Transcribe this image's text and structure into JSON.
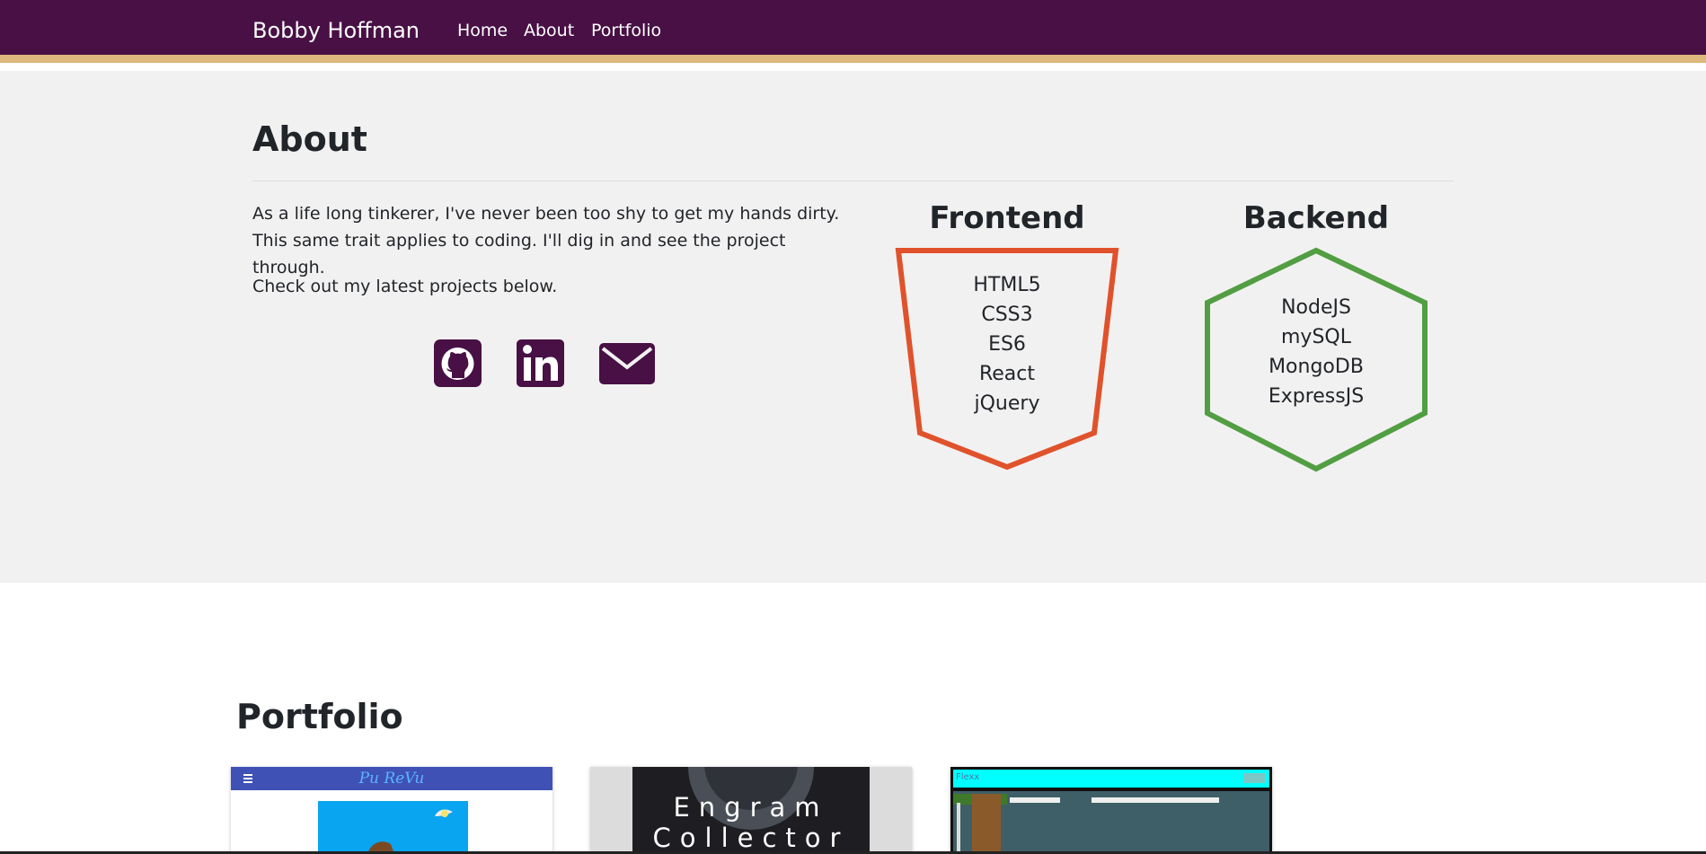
{
  "nav": {
    "brand": "Bobby Hoffman",
    "links": [
      "Home",
      "About",
      "Portfolio"
    ]
  },
  "about": {
    "title": "About",
    "paragraph1": "As a life long tinkerer, I've never been too shy to get my hands dirty. This same trait applies to coding. I'll dig in and see the project through.",
    "paragraph2": "Check out my latest projects below.",
    "social_icons": [
      "github-icon",
      "linkedin-icon",
      "envelope-icon"
    ]
  },
  "skills": {
    "frontend": {
      "title": "Frontend",
      "items": [
        "HTML5",
        "CSS3",
        "ES6",
        "React",
        "jQuery"
      ],
      "color": "#e0522c"
    },
    "backend": {
      "title": "Backend",
      "items": [
        "NodeJS",
        "mySQL",
        "MongoDB",
        "ExpressJS"
      ],
      "color": "#529e43"
    }
  },
  "portfolio": {
    "title": "Portfolio",
    "cards": [
      {
        "title": "Pu ReVu"
      },
      {
        "title": "Engram Collector"
      },
      {
        "title": "Flexx"
      }
    ]
  },
  "colors": {
    "nav_bg": "#481045",
    "nav_accent": "#dcb87e",
    "about_bg": "#f2f1f1"
  }
}
